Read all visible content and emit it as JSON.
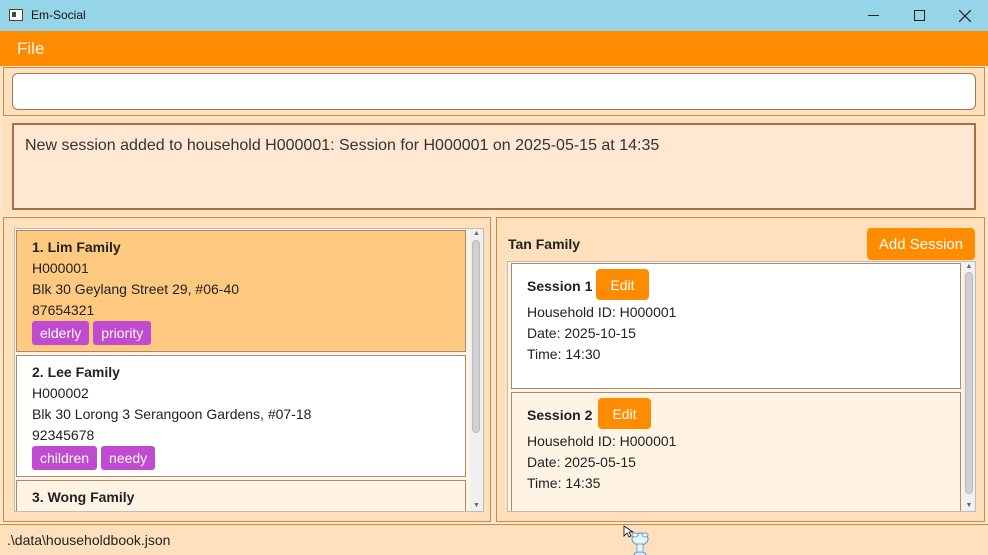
{
  "window": {
    "title": "Em-Social",
    "icon": "app-window-icon"
  },
  "menu": {
    "file": "File"
  },
  "command": {
    "value": "",
    "placeholder": ""
  },
  "result": {
    "text": "New session added to household H000001: Session for H000001 on 2025-05-15 at 14:35"
  },
  "households": [
    {
      "header": "1.  Lim Family",
      "id": "H000001",
      "address": "Blk 30 Geylang Street 29, #06-40",
      "phone": "87654321",
      "tags": [
        "elderly",
        "priority"
      ]
    },
    {
      "header": "2.  Lee Family",
      "id": "H000002",
      "address": "Blk 30 Lorong 3 Serangoon Gardens, #07-18",
      "phone": "92345678",
      "tags": [
        "children",
        "needy"
      ]
    },
    {
      "header": "3.  Wong Family"
    }
  ],
  "details": {
    "household_name": "Tan Family",
    "add_session_label": "Add Session",
    "sessions": [
      {
        "title": "Session 1",
        "edit_label": "Edit",
        "household_id": "Household ID: H000001",
        "date": "Date: 2025-10-15",
        "time": "Time: 14:30"
      },
      {
        "title": "Session 2",
        "edit_label": "Edit",
        "household_id": "Household ID: H000001",
        "date": "Date: 2025-05-15",
        "time": "Time: 14:35"
      }
    ]
  },
  "status": {
    "path": ".\\data\\householdbook.json"
  },
  "colors": {
    "titlebar": "#96d4e8",
    "accent": "#ff8c00",
    "tag": "#c04ad0",
    "selected_card": "#ffca7f",
    "panel": "#ffe0bd"
  }
}
